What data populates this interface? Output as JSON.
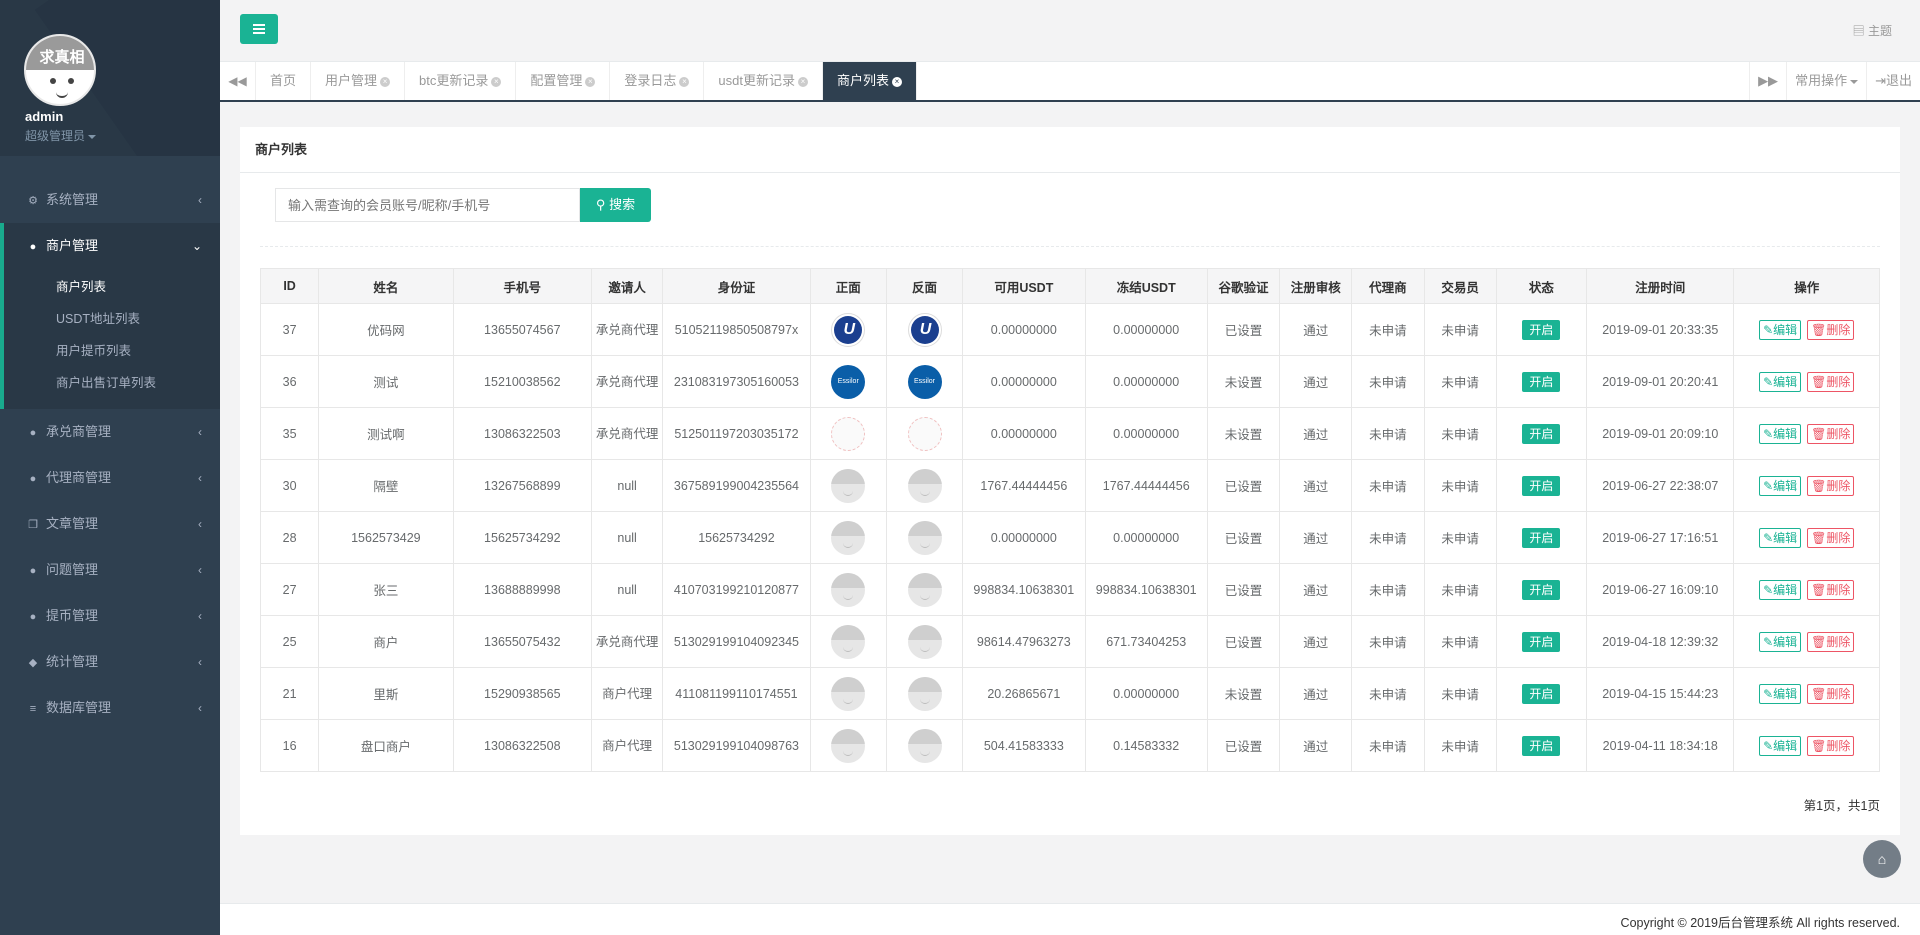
{
  "profile": {
    "logo_text": "求真相",
    "username": "admin",
    "role": "超级管理员"
  },
  "sidebar": {
    "items": [
      {
        "label": "系统管理",
        "icon": "gear-icon"
      },
      {
        "label": "商户管理",
        "icon": "user-icon"
      },
      {
        "label": "承兑商管理",
        "icon": "user-icon"
      },
      {
        "label": "代理商管理",
        "icon": "user-icon"
      },
      {
        "label": "文章管理",
        "icon": "copy-icon"
      },
      {
        "label": "问题管理",
        "icon": "comment-icon"
      },
      {
        "label": "提币管理",
        "icon": "user-icon"
      },
      {
        "label": "统计管理",
        "icon": "cube-icon"
      },
      {
        "label": "数据库管理",
        "icon": "database-icon"
      }
    ],
    "submenu": [
      "商户列表",
      "USDT地址列表",
      "用户提币列表",
      "商户出售订单列表"
    ]
  },
  "header": {
    "theme_label": "主题"
  },
  "tabs": [
    {
      "label": "首页"
    },
    {
      "label": "用户管理"
    },
    {
      "label": "btc更新记录"
    },
    {
      "label": "配置管理"
    },
    {
      "label": "登录日志"
    },
    {
      "label": "usdt更新记录"
    },
    {
      "label": "商户列表"
    }
  ],
  "tab_actions": {
    "common_ops": "常用操作",
    "logout": "退出"
  },
  "panel": {
    "title": "商户列表"
  },
  "search": {
    "placeholder": "输入需查询的会员账号/昵称/手机号",
    "button": "搜索"
  },
  "table": {
    "headers": [
      "ID",
      "姓名",
      "手机号",
      "邀请人",
      "身份证",
      "正面",
      "反面",
      "可用USDT",
      "冻结USDT",
      "谷歌验证",
      "注册审核",
      "代理商",
      "交易员",
      "状态",
      "注册时间",
      "操作"
    ],
    "rows": [
      {
        "id": "37",
        "name": "优码网",
        "phone": "13655074567",
        "inviter": "承兑商代理",
        "idcard": "51052119850508797x",
        "img": "u",
        "usdt": "0.00000000",
        "frozen": "0.00000000",
        "google": "已设置",
        "audit": "通过",
        "agent": "未申请",
        "trader": "未申请",
        "status": "开启",
        "time": "2019-09-01 20:33:35"
      },
      {
        "id": "36",
        "name": "测试",
        "phone": "15210038562",
        "inviter": "承兑商代理",
        "idcard": "231083197305160053",
        "img": "e",
        "usdt": "0.00000000",
        "frozen": "0.00000000",
        "google": "未设置",
        "audit": "通过",
        "agent": "未申请",
        "trader": "未申请",
        "status": "开启",
        "time": "2019-09-01 20:20:41"
      },
      {
        "id": "35",
        "name": "测试啊",
        "phone": "13086322503",
        "inviter": "承兑商代理",
        "idcard": "512501197203035172",
        "img": "c",
        "usdt": "0.00000000",
        "frozen": "0.00000000",
        "google": "未设置",
        "audit": "通过",
        "agent": "未申请",
        "trader": "未申请",
        "status": "开启",
        "time": "2019-09-01 20:09:10"
      },
      {
        "id": "30",
        "name": "隔壁",
        "phone": "13267568899",
        "inviter": "null",
        "idcard": "367589199004235564",
        "img": "d",
        "usdt": "1767.44444456",
        "frozen": "1767.44444456",
        "google": "已设置",
        "audit": "通过",
        "agent": "未申请",
        "trader": "未申请",
        "status": "开启",
        "time": "2019-06-27 22:38:07"
      },
      {
        "id": "28",
        "name": "1562573429",
        "phone": "15625734292",
        "inviter": "null",
        "idcard": "15625734292",
        "img": "d",
        "usdt": "0.00000000",
        "frozen": "0.00000000",
        "google": "已设置",
        "audit": "通过",
        "agent": "未申请",
        "trader": "未申请",
        "status": "开启",
        "time": "2019-06-27 17:16:51"
      },
      {
        "id": "27",
        "name": "张三",
        "phone": "13688889998",
        "inviter": "null",
        "idcard": "410703199210120877",
        "img": "d",
        "usdt": "998834.10638301",
        "frozen": "998834.10638301",
        "google": "已设置",
        "audit": "通过",
        "agent": "未申请",
        "trader": "未申请",
        "status": "开启",
        "time": "2019-06-27 16:09:10"
      },
      {
        "id": "25",
        "name": "商户",
        "phone": "13655075432",
        "inviter": "承兑商代理",
        "idcard": "513029199104092345",
        "img": "d",
        "usdt": "98614.47963273",
        "frozen": "671.73404253",
        "google": "已设置",
        "audit": "通过",
        "agent": "未申请",
        "trader": "未申请",
        "status": "开启",
        "time": "2019-04-18 12:39:32"
      },
      {
        "id": "21",
        "name": "里斯",
        "phone": "15290938565",
        "inviter": "商户代理",
        "idcard": "411081199110174551",
        "img": "d",
        "usdt": "20.26865671",
        "frozen": "0.00000000",
        "google": "未设置",
        "audit": "通过",
        "agent": "未申请",
        "trader": "未申请",
        "status": "开启",
        "time": "2019-04-15 15:44:23"
      },
      {
        "id": "16",
        "name": "盘口商户",
        "phone": "13086322508",
        "inviter": "商户代理",
        "idcard": "513029199104098763",
        "img": "d",
        "usdt": "504.41583333",
        "frozen": "0.14583332",
        "google": "已设置",
        "audit": "通过",
        "agent": "未申请",
        "trader": "未申请",
        "status": "开启",
        "time": "2019-04-11 18:34:18"
      }
    ],
    "edit_label": "编辑",
    "delete_label": "删除"
  },
  "pagination": "第1页，共1页",
  "footer": "Copyright © 2019后台管理系统 All rights reserved.",
  "colors": {
    "sidebar_bg": "#2f4050",
    "accent": "#1ab394",
    "danger": "#ed5565"
  }
}
